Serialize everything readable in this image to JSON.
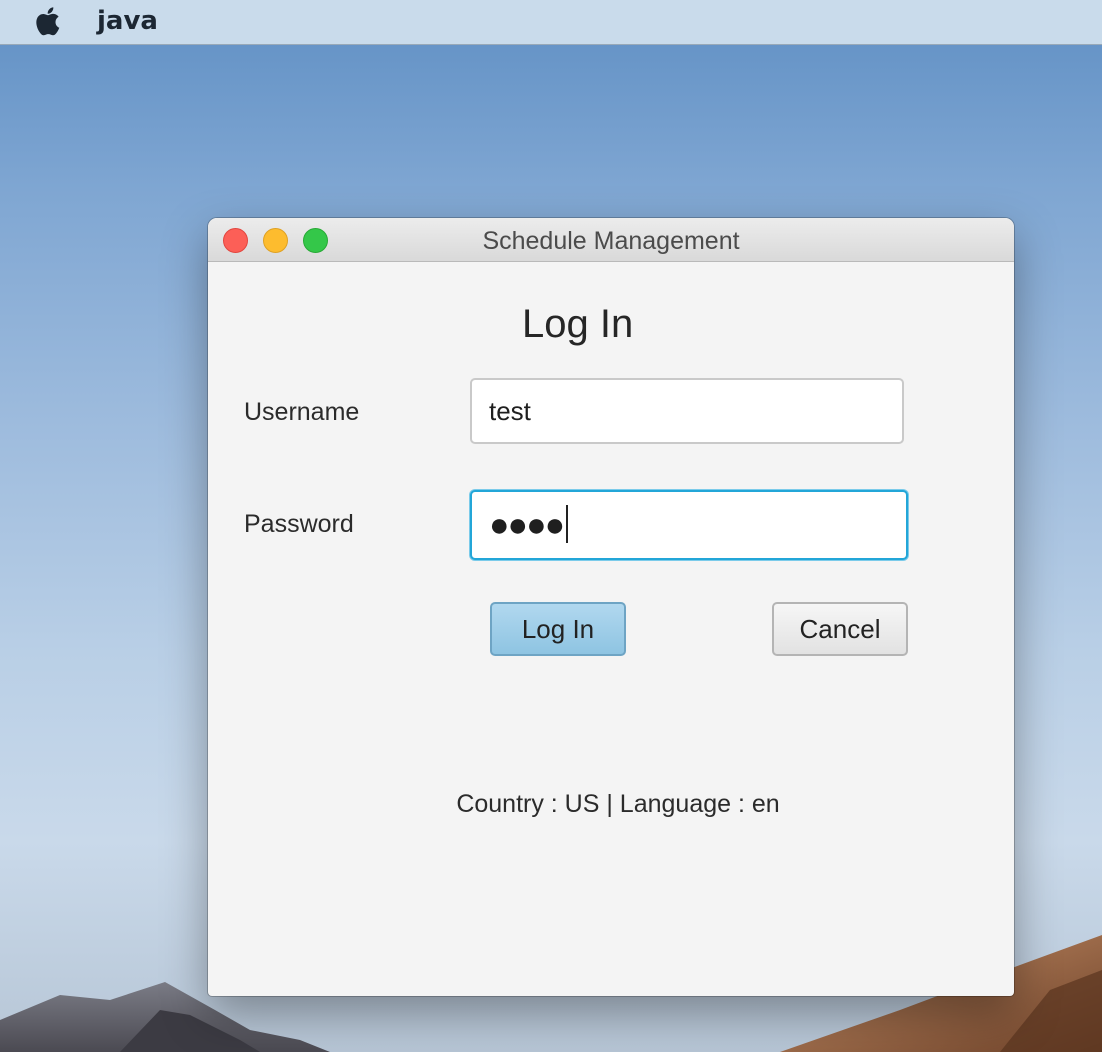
{
  "menubar": {
    "app_name": "java",
    "apple_icon": "apple-logo-icon"
  },
  "window": {
    "title": "Schedule Management",
    "controls": [
      "close",
      "minimize",
      "zoom"
    ],
    "colors": {
      "close": "#fc5f57",
      "minimize": "#fdbc2e",
      "zoom": "#34c749"
    }
  },
  "form": {
    "heading": "Log In",
    "username_label": "Username",
    "username_value": "test",
    "password_label": "Password",
    "password_masked": "●●●●",
    "login_button": "Log In",
    "cancel_button": "Cancel",
    "focus_color": "#23a6d8"
  },
  "footer": {
    "locale_text": "Country : US | Language : en"
  }
}
